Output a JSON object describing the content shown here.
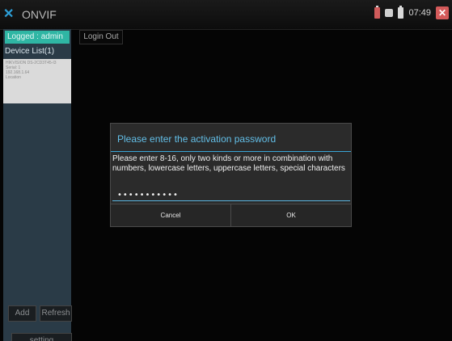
{
  "topbar": {
    "app_name": "ONVIF",
    "time": "07:49"
  },
  "left_panel": {
    "logged_label": "Logged : admin",
    "device_list_title": "Device List(1)",
    "device": {
      "name": "HIKVISION DS-2CD3T45-I3",
      "serial": "Serial: 1",
      "ip": "192.168.1.64",
      "location": "Location"
    },
    "add_label": "Add",
    "refresh_label": "Refresh",
    "setting_label": "setting"
  },
  "main": {
    "login_out_label": "Login Out"
  },
  "dialog": {
    "title": "Please enter the activation password",
    "message": "Please enter 8-16, only two kinds or more in combination with numbers, lowercase letters, uppercase letters, special characters",
    "password_mask": "•••••••••••",
    "cancel_label": "Cancel",
    "ok_label": "OK"
  },
  "colors": {
    "accent": "#2fb6a4",
    "dialog_title": "#63bfe8",
    "close_red": "#d45a5a"
  }
}
